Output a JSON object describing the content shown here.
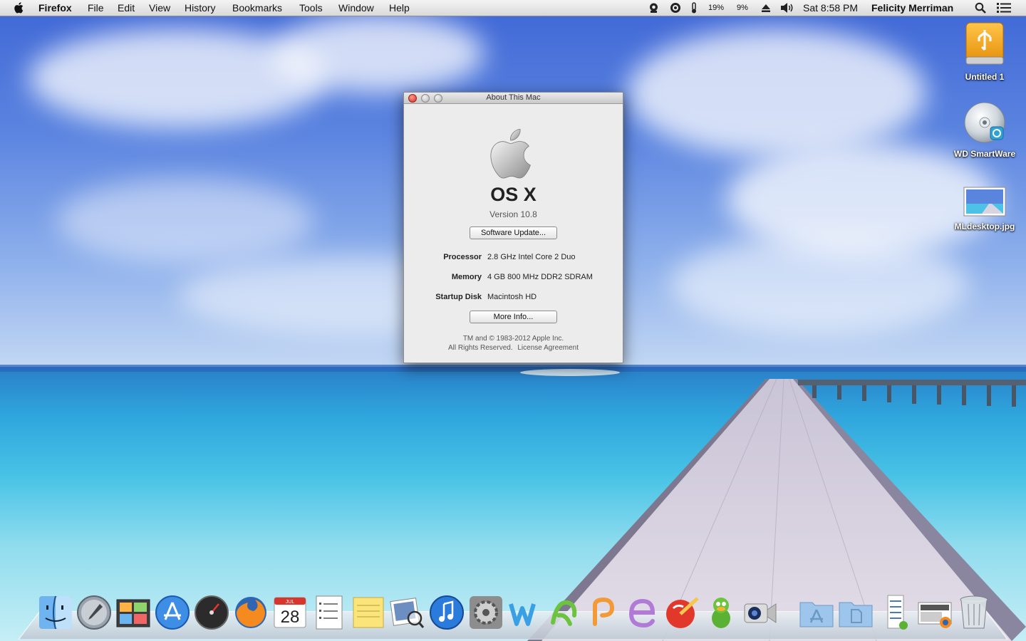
{
  "menubar": {
    "app_name": "Firefox",
    "menus": [
      "File",
      "Edit",
      "View",
      "History",
      "Bookmarks",
      "Tools",
      "Window",
      "Help"
    ],
    "status": {
      "battery_1": "19%",
      "battery_2": "9%",
      "clock": "Sat 8:58 PM",
      "user": "Felicity Merriman"
    }
  },
  "desktop_icons": [
    {
      "label": "Untitled 1",
      "icon": "usb-drive-icon"
    },
    {
      "label": "WD SmartWare",
      "icon": "cd-disc-icon"
    },
    {
      "label": "MLdesktop.jpg",
      "icon": "image-file-icon"
    }
  ],
  "about_window": {
    "title": "About This Mac",
    "os_name": "OS X",
    "version": "Version 10.8",
    "software_update_label": "Software Update...",
    "specs": {
      "processor_label": "Processor",
      "processor_value": "2.8 GHz Intel Core 2 Duo",
      "memory_label": "Memory",
      "memory_value": "4 GB 800 MHz DDR2 SDRAM",
      "startup_label": "Startup Disk",
      "startup_value": "Macintosh HD"
    },
    "more_info_label": "More Info...",
    "copyright": "TM and © 1983-2012 Apple Inc.",
    "rights": "All Rights Reserved.",
    "license": "License Agreement"
  },
  "dock": {
    "apps": [
      "finder",
      "launchpad",
      "photo-booth",
      "app-store",
      "dashboard",
      "firefox",
      "calendar",
      "reminders",
      "stickies",
      "preview",
      "itunes",
      "system-preferences",
      "wunderlist",
      "jumpcut",
      "pages-like",
      "tweetdeck-like",
      "ccleaner",
      "adium",
      "facetime-camera",
      "applications-folder",
      "documents-folder",
      "downloads-stack",
      "screenshot-stack",
      "trash"
    ],
    "calendar_month": "JUL",
    "calendar_day": "28"
  }
}
